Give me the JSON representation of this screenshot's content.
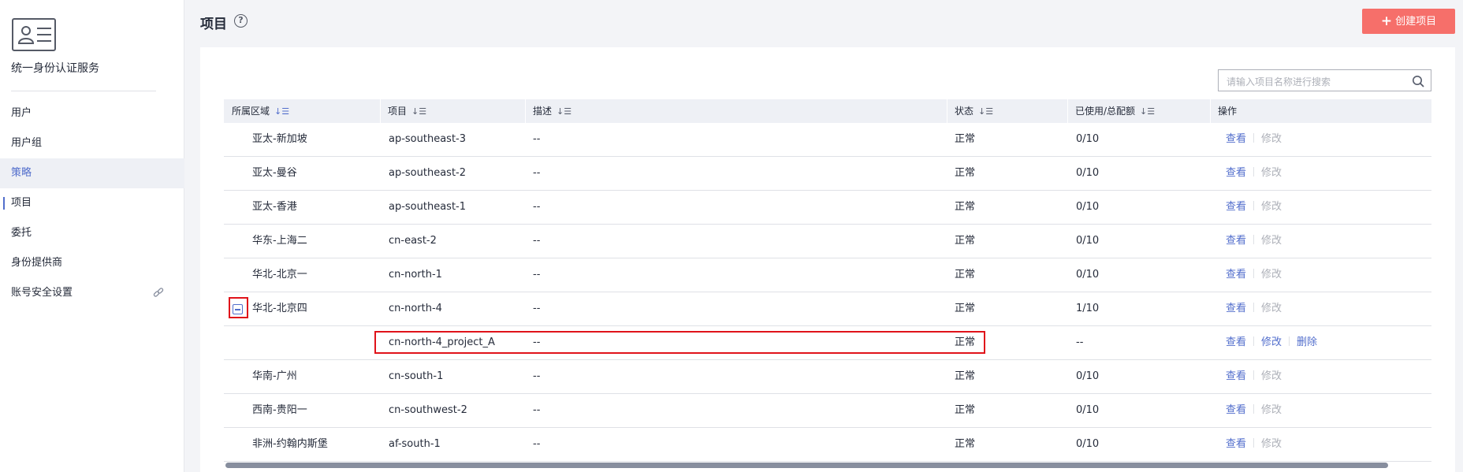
{
  "sidebar": {
    "service_title": "统一身份认证服务",
    "items": [
      {
        "label": "用户"
      },
      {
        "label": "用户组"
      },
      {
        "label": "策略"
      },
      {
        "label": "项目"
      },
      {
        "label": "委托"
      },
      {
        "label": "身份提供商"
      },
      {
        "label": "账号安全设置"
      }
    ],
    "active_item": "项目",
    "hovered_item": "策略"
  },
  "header": {
    "title": "项目",
    "help_icon": "question-circle-icon",
    "create_button": "创建项目",
    "create_icon": "plus-icon"
  },
  "search": {
    "placeholder": "请输入项目名称进行搜索",
    "icon": "search-icon"
  },
  "table": {
    "columns": [
      "所属区域",
      "项目",
      "描述",
      "状态",
      "已使用/总配额",
      "操作"
    ],
    "actions": {
      "view": "查看",
      "modify": "修改",
      "delete": "删除"
    },
    "rows": [
      {
        "region": "亚太-新加坡",
        "project": "ap-southeast-3",
        "desc": "--",
        "status": "正常",
        "quota": "0/10"
      },
      {
        "region": "亚太-曼谷",
        "project": "ap-southeast-2",
        "desc": "--",
        "status": "正常",
        "quota": "0/10"
      },
      {
        "region": "亚太-香港",
        "project": "ap-southeast-1",
        "desc": "--",
        "status": "正常",
        "quota": "0/10"
      },
      {
        "region": "华东-上海二",
        "project": "cn-east-2",
        "desc": "--",
        "status": "正常",
        "quota": "0/10"
      },
      {
        "region": "华北-北京一",
        "project": "cn-north-1",
        "desc": "--",
        "status": "正常",
        "quota": "0/10"
      },
      {
        "region": "华北-北京四",
        "project": "cn-north-4",
        "desc": "--",
        "status": "正常",
        "quota": "1/10"
      },
      {
        "region": "",
        "project": "cn-north-4_project_A",
        "desc": "--",
        "status": "正常",
        "quota": "--"
      },
      {
        "region": "华南-广州",
        "project": "cn-south-1",
        "desc": "--",
        "status": "正常",
        "quota": "0/10"
      },
      {
        "region": "西南-贵阳一",
        "project": "cn-southwest-2",
        "desc": "--",
        "status": "正常",
        "quota": "0/10"
      },
      {
        "region": "非洲-约翰内斯堡",
        "project": "af-south-1",
        "desc": "--",
        "status": "正常",
        "quota": "0/10"
      }
    ]
  },
  "colors": {
    "accent": "#526ecc",
    "create_button": "#f66f6a",
    "highlight_box": "#e0131a"
  }
}
